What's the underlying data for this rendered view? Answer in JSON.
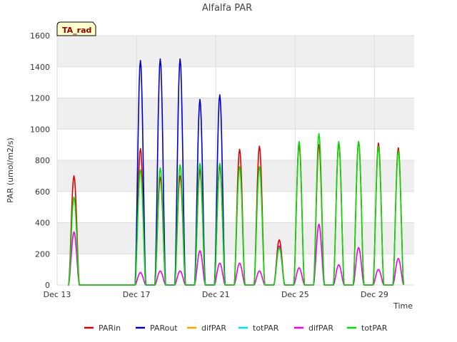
{
  "chart_data": {
    "type": "line",
    "title": "Alfalfa PAR",
    "xlabel": "Time",
    "ylabel": "PAR (umol/m2/s)",
    "badge": "TA_rad",
    "ylim": [
      0,
      1600
    ],
    "xlim": [
      13,
      31
    ],
    "x_unit": "day of December",
    "x_ticks": [
      {
        "value": 13,
        "label": "Dec 13"
      },
      {
        "value": 17,
        "label": "Dec 17"
      },
      {
        "value": 21,
        "label": "Dec 21"
      },
      {
        "value": 25,
        "label": "Dec 25"
      },
      {
        "value": 29,
        "label": "Dec 29"
      }
    ],
    "y_ticks": [
      0,
      200,
      400,
      600,
      800,
      1000,
      1200,
      1400,
      1600
    ],
    "grid": true,
    "legend_position": "bottom",
    "series": [
      {
        "name": "PARin",
        "color": "#dd0000",
        "peaks": [
          {
            "x": 13.85,
            "y": 700
          },
          {
            "x": 17.2,
            "y": 875
          },
          {
            "x": 18.2,
            "y": 690
          },
          {
            "x": 19.2,
            "y": 700
          },
          {
            "x": 20.2,
            "y": 740
          },
          {
            "x": 21.2,
            "y": 760
          },
          {
            "x": 22.2,
            "y": 870
          },
          {
            "x": 23.2,
            "y": 890
          },
          {
            "x": 24.2,
            "y": 290
          },
          {
            "x": 25.2,
            "y": 900
          },
          {
            "x": 26.2,
            "y": 900
          },
          {
            "x": 27.2,
            "y": 910
          },
          {
            "x": 28.2,
            "y": 920
          },
          {
            "x": 29.2,
            "y": 910
          },
          {
            "x": 30.2,
            "y": 880
          }
        ]
      },
      {
        "name": "PARout",
        "color": "#0000cc",
        "peaks": [
          {
            "x": 17.2,
            "y": 1440
          },
          {
            "x": 18.2,
            "y": 1450
          },
          {
            "x": 19.2,
            "y": 1450
          },
          {
            "x": 20.2,
            "y": 1190
          },
          {
            "x": 21.2,
            "y": 1220
          }
        ]
      },
      {
        "name": "difPAR",
        "color": "#ffa500"
      },
      {
        "name": "totPAR",
        "color": "#00e5e5"
      },
      {
        "name": "difPAR",
        "color": "#ee00ee",
        "peaks": [
          {
            "x": 13.85,
            "y": 340
          },
          {
            "x": 17.2,
            "y": 80
          },
          {
            "x": 18.2,
            "y": 90
          },
          {
            "x": 19.2,
            "y": 90
          },
          {
            "x": 20.2,
            "y": 220
          },
          {
            "x": 21.2,
            "y": 140
          },
          {
            "x": 22.2,
            "y": 140
          },
          {
            "x": 23.2,
            "y": 90
          },
          {
            "x": 24.2,
            "y": 250
          },
          {
            "x": 25.2,
            "y": 110
          },
          {
            "x": 26.2,
            "y": 390
          },
          {
            "x": 27.2,
            "y": 130
          },
          {
            "x": 28.2,
            "y": 240
          },
          {
            "x": 29.2,
            "y": 100
          },
          {
            "x": 30.2,
            "y": 170
          }
        ]
      },
      {
        "name": "totPAR",
        "color": "#00dd00",
        "peaks": [
          {
            "x": 13.85,
            "y": 565
          },
          {
            "x": 17.2,
            "y": 740
          },
          {
            "x": 18.2,
            "y": 750
          },
          {
            "x": 19.2,
            "y": 770
          },
          {
            "x": 20.2,
            "y": 780
          },
          {
            "x": 21.2,
            "y": 780
          },
          {
            "x": 22.2,
            "y": 760
          },
          {
            "x": 23.2,
            "y": 760
          },
          {
            "x": 24.2,
            "y": 240
          },
          {
            "x": 25.2,
            "y": 920
          },
          {
            "x": 26.2,
            "y": 970
          },
          {
            "x": 27.2,
            "y": 920
          },
          {
            "x": 28.2,
            "y": 920
          },
          {
            "x": 29.2,
            "y": 890
          },
          {
            "x": 30.2,
            "y": 860
          }
        ]
      }
    ]
  }
}
